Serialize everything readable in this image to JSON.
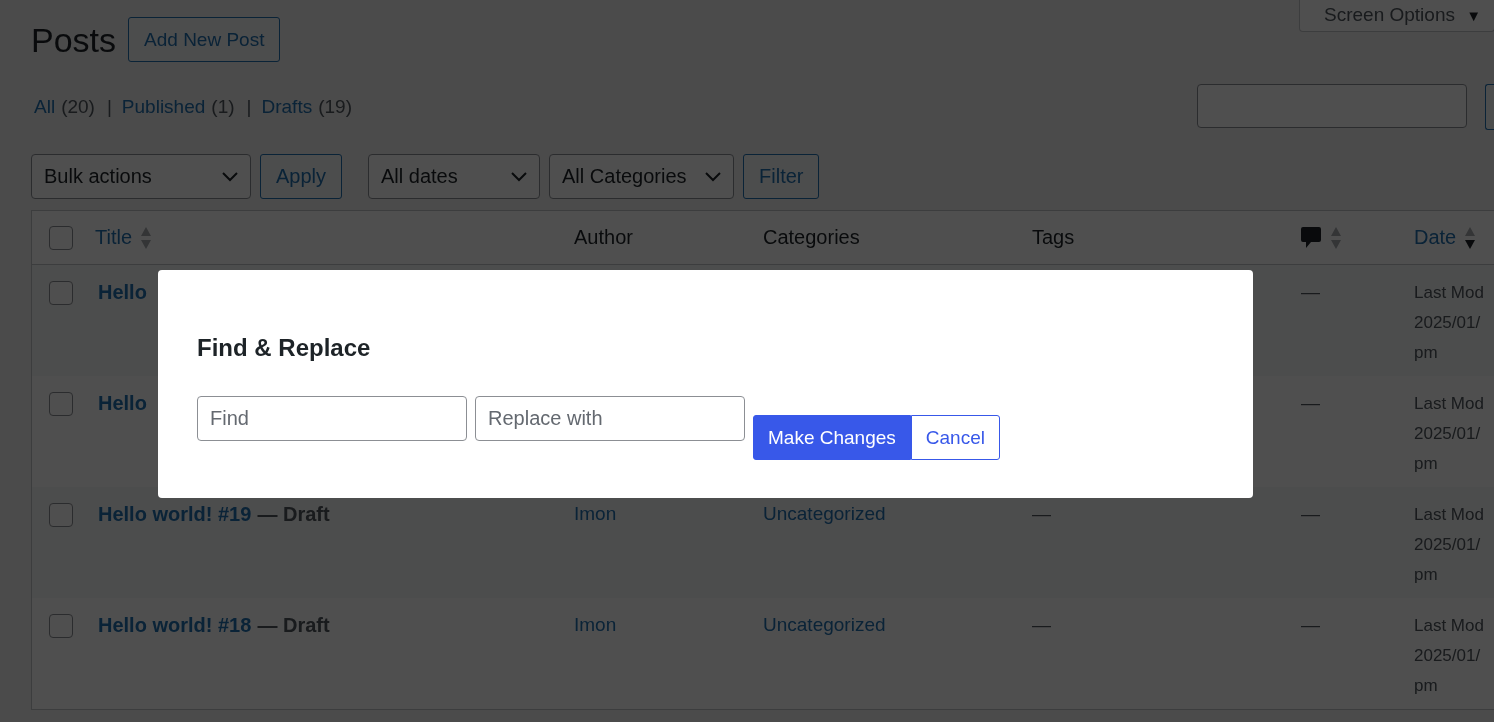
{
  "screen_options": {
    "label": "Screen Options",
    "caret": "▼"
  },
  "page_title": "Posts",
  "add_new_button": "Add New Post",
  "views": [
    {
      "label": "All",
      "count": "(20)"
    },
    {
      "label": "Published",
      "count": "(1)"
    },
    {
      "label": "Drafts",
      "count": "(19)"
    }
  ],
  "view_separator": "|",
  "toolbar": [
    {
      "kind": "select",
      "label": "Bulk actions"
    },
    {
      "kind": "button",
      "label": "Apply"
    },
    {
      "kind": "select",
      "label": "All dates"
    },
    {
      "kind": "select",
      "label": "All Categories"
    },
    {
      "kind": "button",
      "label": "Filter"
    }
  ],
  "table": {
    "select_all": {
      "checked": false
    },
    "columns": [
      {
        "kind": "link",
        "label": "Title",
        "sorted": false
      },
      {
        "kind": "text",
        "label": "Author"
      },
      {
        "kind": "text",
        "label": "Categories"
      },
      {
        "kind": "text",
        "label": "Tags"
      },
      {
        "kind": "icon",
        "sorted": false
      },
      {
        "kind": "link",
        "label": "Date",
        "sorted": true
      }
    ],
    "rows": [
      {
        "checked": false,
        "title": "Hello",
        "comments": "—",
        "date": [
          "Last Mod",
          "2025/01/",
          "pm"
        ]
      },
      {
        "checked": false,
        "title": "Hello",
        "comments": "—",
        "date": [
          "Last Mod",
          "2025/01/",
          "pm"
        ]
      },
      {
        "checked": false,
        "title": "Hello world! #19",
        "state": "— Draft",
        "author": "Imon",
        "categories": "Uncategorized",
        "tags": "—",
        "comments": "—",
        "date": [
          "Last Mod",
          "2025/01/",
          "pm"
        ]
      },
      {
        "checked": false,
        "title": "Hello world! #18",
        "state": "— Draft",
        "author": "Imon",
        "categories": "Uncategorized",
        "tags": "—",
        "comments": "—",
        "date": [
          "Last Mod",
          "2025/01/",
          "pm"
        ]
      }
    ]
  },
  "dialog": {
    "title": "Find & Replace",
    "find": {
      "placeholder": "Find"
    },
    "replace": {
      "placeholder": "Replace with"
    },
    "buttons": [
      {
        "kind": "primary",
        "label": "Make Changes"
      },
      {
        "kind": "secondary",
        "label": "Cancel"
      }
    ]
  }
}
